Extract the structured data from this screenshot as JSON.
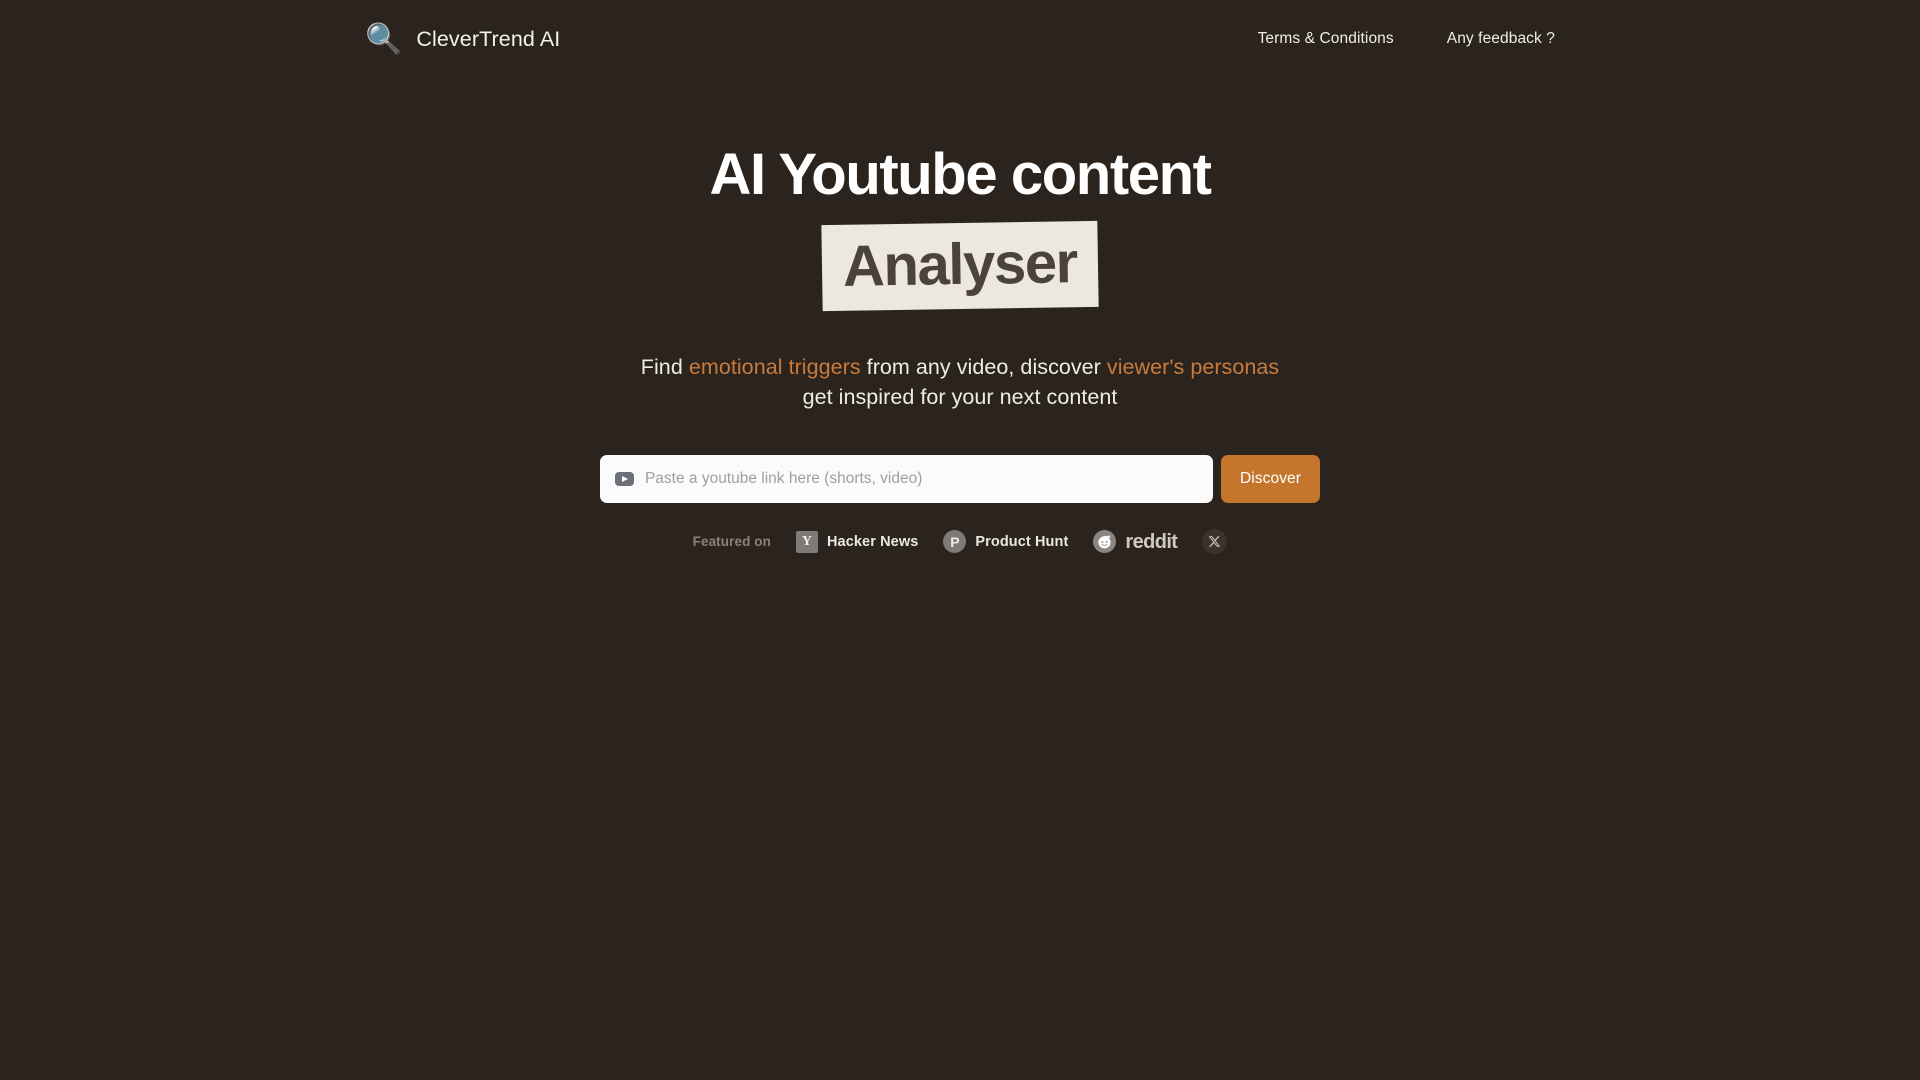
{
  "theme": {
    "background": "#2b231d",
    "accent_orange": "#c97b3c",
    "button_orange": "#c4762c",
    "highlight_bg": "#ece7e0",
    "highlight_text": "#4b423a",
    "text_primary": "#f2ede6",
    "muted": "#8a817a"
  },
  "header": {
    "logo_icon": "magnifying-glass-icon",
    "logo_glyph": "🔍",
    "brand": "CleverTrend AI",
    "nav": [
      {
        "label": "Terms & Conditions"
      },
      {
        "label": "Any feedback ?"
      }
    ]
  },
  "hero": {
    "headline_line1": "AI Youtube content",
    "headline_line2_highlight": "Analyser",
    "subtitle": {
      "part1": "Find ",
      "accent1": "emotional triggers",
      "part2": " from any video, discover ",
      "accent2": "viewer's personas",
      "line2": "get inspired for your next content"
    }
  },
  "search": {
    "icon": "youtube-icon",
    "placeholder": "Paste a youtube link here (shorts, video)",
    "value": "",
    "button_label": "Discover"
  },
  "featured": {
    "label": "Featured on",
    "items": [
      {
        "name": "Hacker News",
        "icon": "hacker-news-icon",
        "mark": "Y",
        "show_name": true
      },
      {
        "name": "Product Hunt",
        "icon": "product-hunt-icon",
        "mark": "P",
        "show_name": true
      },
      {
        "name": "reddit",
        "icon": "reddit-icon",
        "mark": "",
        "show_name": true
      },
      {
        "name": "",
        "icon": "x-twitter-icon",
        "mark": "",
        "show_name": false
      }
    ]
  }
}
